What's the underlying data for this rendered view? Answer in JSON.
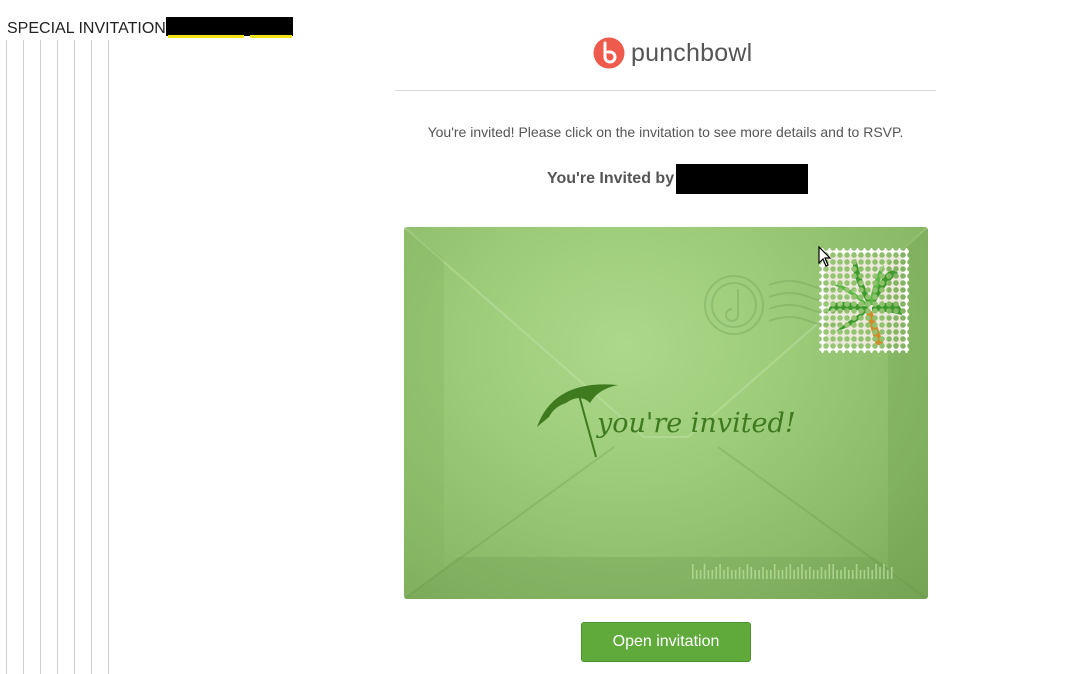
{
  "email": {
    "subject": "SPECIAL INVITATION"
  },
  "brand": {
    "name": "punchbowl",
    "logo_color": "#ee5a4b"
  },
  "message": {
    "intro": "You're invited! Please click on the invitation to see more details and to RSVP.",
    "invited_by_label": "You're Invited by"
  },
  "envelope": {
    "greeting": "you're invited!",
    "color": "#9ccc79",
    "accent_color": "#3f7a1f",
    "umbrella_icon": "umbrella-icon",
    "stamp_icon": "palm-tree-icon"
  },
  "actions": {
    "open_label": "Open invitation",
    "button_color": "#5faa3b"
  }
}
